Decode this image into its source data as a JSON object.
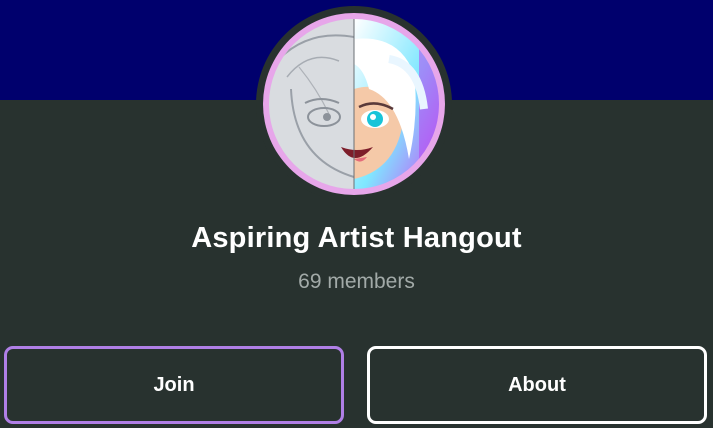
{
  "group": {
    "name": "Aspiring Artist Hangout",
    "member_count": "69 members"
  },
  "actions": {
    "join_label": "Join",
    "about_label": "About"
  },
  "colors": {
    "banner": "#00006d",
    "background": "#28322f",
    "avatar_ring": "#e7a6ea",
    "join_border": "#b07fe6",
    "about_border": "#ffffff"
  },
  "icons": {
    "avatar": "anime-character-avatar"
  }
}
